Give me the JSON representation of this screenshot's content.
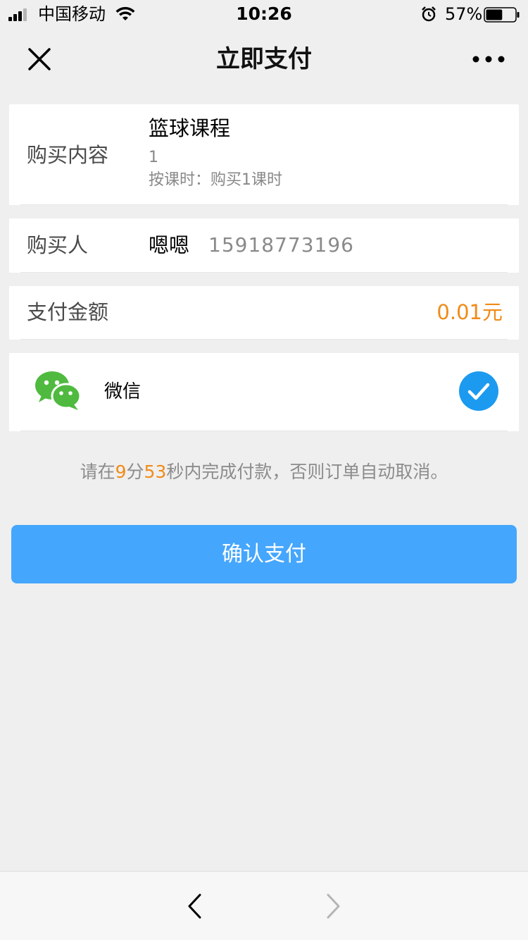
{
  "status_bar": {
    "carrier": "中国移动",
    "time": "10:26",
    "battery_percent": "57%",
    "battery_level": 0.57,
    "icons": [
      "signal-icon",
      "wifi-icon",
      "alarm-icon",
      "battery-icon"
    ]
  },
  "nav": {
    "title": "立即支付",
    "icons": [
      "close-icon",
      "more-icon"
    ]
  },
  "purchase": {
    "label": "购买内容",
    "course_name": "篮球课程",
    "quantity": "1",
    "detail": "按课时：购买1课时"
  },
  "buyer": {
    "label": "购买人",
    "name": "嗯嗯",
    "phone": "15918773196"
  },
  "amount": {
    "label": "支付金额",
    "value": "0.01元"
  },
  "payment_method": {
    "label": "微信",
    "selected": true,
    "icons": [
      "wechat-icon",
      "check-icon"
    ],
    "colors": {
      "wechat": "#4fba3f",
      "check": "#1c9af0"
    }
  },
  "countdown": {
    "prefix": "请在",
    "minutes": "9",
    "minutes_unit": "分",
    "seconds": "53",
    "suffix": "秒内完成付款，否则订单自动取消。"
  },
  "confirm_button": {
    "label": "确认支付",
    "color": "#45a6fd"
  },
  "bottom_bar": {
    "icons": [
      "back-arrow-icon",
      "forward-arrow-icon"
    ]
  },
  "colors": {
    "background": "#efefef",
    "accent_orange": "#f08b18"
  }
}
